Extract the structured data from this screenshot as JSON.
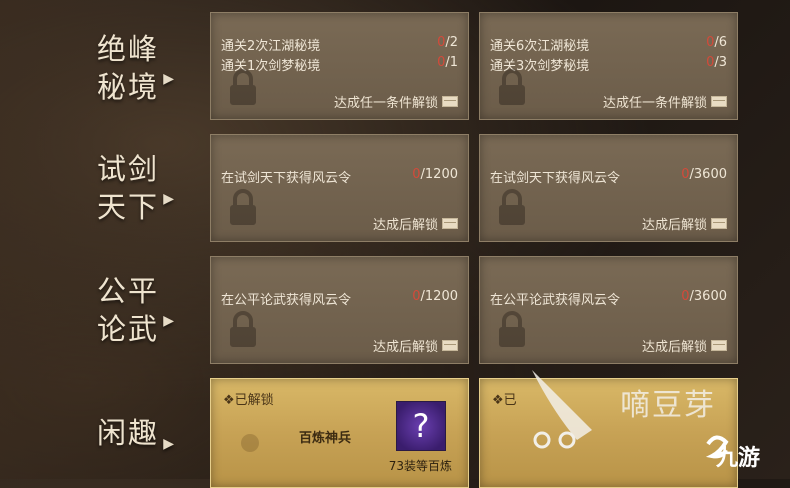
{
  "rows": [
    {
      "label_line1": "绝峰",
      "label_line2": "秘境",
      "cards": [
        {
          "reqs": [
            {
              "text": "通关2次江湖秘境",
              "current": "0",
              "total": "/2"
            },
            {
              "text": "通关1次剑梦秘境",
              "current": "0",
              "total": "/1"
            }
          ],
          "unlock": "达成任一条件解锁"
        },
        {
          "reqs": [
            {
              "text": "通关6次江湖秘境",
              "current": "0",
              "total": "/6"
            },
            {
              "text": "通关3次剑梦秘境",
              "current": "0",
              "total": "/3"
            }
          ],
          "unlock": "达成任一条件解锁"
        }
      ]
    },
    {
      "label_line1": "试剑",
      "label_line2": "天下",
      "cards": [
        {
          "reqs": [
            {
              "text": "在试剑天下获得风云令",
              "current": "0",
              "total": "/1200"
            }
          ],
          "unlock": "达成后解锁"
        },
        {
          "reqs": [
            {
              "text": "在试剑天下获得风云令",
              "current": "0",
              "total": "/3600"
            }
          ],
          "unlock": "达成后解锁"
        }
      ]
    },
    {
      "label_line1": "公平",
      "label_line2": "论武",
      "cards": [
        {
          "reqs": [
            {
              "text": "在公平论武获得风云令",
              "current": "0",
              "total": "/1200"
            }
          ],
          "unlock": "达成后解锁"
        },
        {
          "reqs": [
            {
              "text": "在公平论武获得风云令",
              "current": "0",
              "total": "/3600"
            }
          ],
          "unlock": "达成后解锁"
        }
      ]
    },
    {
      "label_line1": "闲趣",
      "label_line2": "",
      "cards": [
        {
          "status": "❖已解锁",
          "reward": "百炼神兵",
          "reward_sub": "73装等百炼",
          "icon": "?"
        },
        {
          "status": "❖已"
        }
      ]
    }
  ],
  "watermark": {
    "text": "嘀豆芽",
    "logo": "九游"
  }
}
